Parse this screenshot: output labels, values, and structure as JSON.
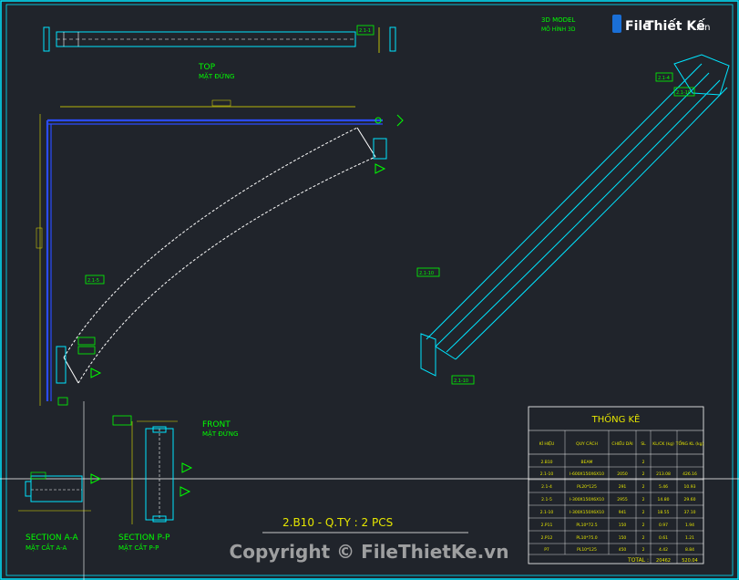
{
  "watermark_top": {
    "brand_a": "File",
    "brand_b": "Thiết Kế",
    "brand_suffix": ".vn"
  },
  "watermark_bottom": "Copyright © FileThietKe.vn",
  "views": {
    "top": {
      "title": "TOP",
      "subtitle": "MẶT ĐỨNG"
    },
    "model3d": {
      "title": "3D MODEL",
      "subtitle": "MÔ HÌNH 3D"
    },
    "front": {
      "title": "FRONT",
      "subtitle": "MẶT ĐỨNG"
    },
    "section_aa": {
      "title": "SECTION A-A",
      "subtitle": "MẶT CẮT A-A"
    },
    "section_pp": {
      "title": "SECTION P-P",
      "subtitle": "MẶT CẮT P-P"
    }
  },
  "part_tags": {
    "top_right": "2.1-1",
    "model_top": "2.1-4",
    "model_right": "2.1-10",
    "model_mid": "2.1-10",
    "model_bottom": "2.1-10",
    "elev_mid": "2.1-5"
  },
  "main_title": "2.B10 - Q.TY : 2 PCS",
  "table": {
    "title": "THỐNG KÊ",
    "headers": [
      "KÍ HIỆU",
      "QUY CÁCH",
      "CHIỀU DÀI",
      "SL",
      "KL/CK (kg)",
      "TỔNG KL (kg)"
    ],
    "rows": [
      [
        "2.B10",
        "BEAM",
        "",
        "2",
        "",
        ""
      ],
      [
        "2.1-10",
        "I-600X150X6X10",
        "2050",
        "2",
        "213.08",
        "426.16"
      ],
      [
        "2.1-4",
        "PL20*125",
        "291",
        "2",
        "5.46",
        "10.93"
      ],
      [
        "2.1-5",
        "I-300X150X6X10",
        "2955",
        "2",
        "14.80",
        "29.60"
      ],
      [
        "2.1-10",
        "I-300X150X6X10",
        "941",
        "2",
        "18.55",
        "37.10"
      ],
      [
        "2.P11",
        "PL10*72.5",
        "150",
        "2",
        "0.97",
        "1.94"
      ],
      [
        "2.P12",
        "PL10*75.0",
        "150",
        "2",
        "0.61",
        "1.21"
      ],
      [
        "P7",
        "PL10*125",
        "450",
        "2",
        "4.42",
        "8.84"
      ]
    ],
    "total_label": "TOTAL :",
    "total_length": "20462",
    "total_weight": "520.04"
  }
}
